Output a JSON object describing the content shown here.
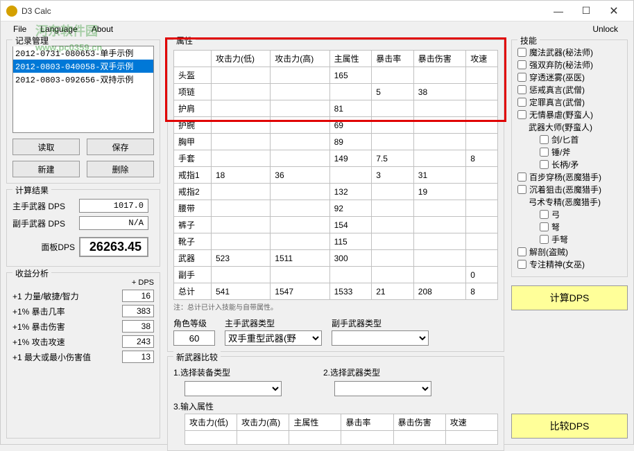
{
  "window": {
    "title": "D3 Calc"
  },
  "menu": {
    "file": "File",
    "language": "Language",
    "about": "About",
    "unlock": "Unlock"
  },
  "watermark": {
    "text": "河东软件园",
    "url": "www.pc0359.cn"
  },
  "records": {
    "title": "记录管理",
    "items": [
      "2012-0731-080653-单手示例",
      "2012-0803-040058-双手示例",
      "2012-0803-092656-双持示例"
    ],
    "selected": 1,
    "read": "读取",
    "save": "保存",
    "new": "新建",
    "delete": "删除"
  },
  "result": {
    "title": "计算结果",
    "main_label": "主手武器 DPS",
    "main_val": "1017.0",
    "off_label": "副手武器 DPS",
    "off_val": "N/A",
    "panel_label": "面板DPS",
    "panel_val": "26263.45"
  },
  "benefit": {
    "title": "收益分析",
    "hdr": "+ DPS",
    "rows": [
      {
        "label": "+1  力量/敏捷/智力",
        "val": "16"
      },
      {
        "label": "+1% 暴击几率",
        "val": "383"
      },
      {
        "label": "+1% 暴击伤害",
        "val": "38"
      },
      {
        "label": "+1% 攻击攻速",
        "val": "243"
      },
      {
        "label": "+1  最大或最小伤害值",
        "val": "13"
      }
    ]
  },
  "attr": {
    "title": "属性",
    "cols": [
      "",
      "攻击力(低)",
      "攻击力(高)",
      "主属性",
      "暴击率",
      "暴击伤害",
      "攻速"
    ],
    "rows": [
      {
        "n": "头盔",
        "c": [
          "",
          "",
          "165",
          "",
          "",
          ""
        ]
      },
      {
        "n": "项链",
        "c": [
          "",
          "",
          "",
          "5",
          "38",
          ""
        ]
      },
      {
        "n": "护肩",
        "c": [
          "",
          "",
          "81",
          "",
          "",
          ""
        ]
      },
      {
        "n": "护腕",
        "c": [
          "",
          "",
          "69",
          "",
          "",
          ""
        ]
      },
      {
        "n": "胸甲",
        "c": [
          "",
          "",
          "89",
          "",
          "",
          ""
        ]
      },
      {
        "n": "手套",
        "c": [
          "",
          "",
          "149",
          "7.5",
          "",
          "8"
        ]
      },
      {
        "n": "戒指1",
        "c": [
          "18",
          "36",
          "",
          "3",
          "31",
          ""
        ]
      },
      {
        "n": "戒指2",
        "c": [
          "",
          "",
          "132",
          "",
          "19",
          ""
        ]
      },
      {
        "n": "腰带",
        "c": [
          "",
          "",
          "92",
          "",
          "",
          ""
        ]
      },
      {
        "n": "裤子",
        "c": [
          "",
          "",
          "154",
          "",
          "",
          ""
        ]
      },
      {
        "n": "靴子",
        "c": [
          "",
          "",
          "115",
          "",
          "",
          ""
        ]
      },
      {
        "n": "武器",
        "c": [
          "523",
          "1511",
          "300",
          "",
          "",
          ""
        ]
      },
      {
        "n": "副手",
        "c": [
          "",
          "",
          "",
          "",
          "",
          "0"
        ]
      },
      {
        "n": "总计",
        "c": [
          "541",
          "1547",
          "1533",
          "21",
          "208",
          "8"
        ]
      }
    ],
    "note": "注：总计已计入技能与自带属性。",
    "level_label": "角色等级",
    "level": "60",
    "main_type_label": "主手武器类型",
    "main_type": "双手重型武器(野",
    "off_type_label": "副手武器类型",
    "off_type": ""
  },
  "skills": {
    "title": "技能",
    "items": [
      {
        "indent": 0,
        "label": "魔法武器(秘法师)"
      },
      {
        "indent": 0,
        "label": "强双弃防(秘法师)"
      },
      {
        "indent": 0,
        "label": "穿透迷雾(巫医)"
      },
      {
        "indent": 0,
        "label": "惩戒真言(武僧)"
      },
      {
        "indent": 0,
        "label": "定罪真言(武僧)"
      },
      {
        "indent": 0,
        "label": "无情暴虐(野蛮人)"
      },
      {
        "indent": 1,
        "label": "武器大师(野蛮人)",
        "nolabel": true
      },
      {
        "indent": 2,
        "label": "剑/匕首"
      },
      {
        "indent": 2,
        "label": "锤/斧"
      },
      {
        "indent": 2,
        "label": "长柄/矛"
      },
      {
        "indent": 0,
        "label": "百步穿杨(恶魔猎手)"
      },
      {
        "indent": 0,
        "label": "沉着狙击(恶魔猎手)"
      },
      {
        "indent": 1,
        "label": "弓术专精(恶魔猎手)",
        "nolabel": true
      },
      {
        "indent": 2,
        "label": "弓"
      },
      {
        "indent": 2,
        "label": "弩"
      },
      {
        "indent": 2,
        "label": "手弩"
      },
      {
        "indent": 0,
        "label": "解剖(盗贼)"
      },
      {
        "indent": 0,
        "label": "专注精神(女巫)"
      }
    ],
    "calc_btn": "计算DPS"
  },
  "newweapon": {
    "title": "新武器比较",
    "step1": "1.选择装备类型",
    "step2": "2.选择武器类型",
    "step3": "3.输入属性",
    "cols": [
      "攻击力(低)",
      "攻击力(高)",
      "主属性",
      "暴击率",
      "暴击伤害",
      "攻速"
    ],
    "compare_btn": "比较DPS"
  }
}
